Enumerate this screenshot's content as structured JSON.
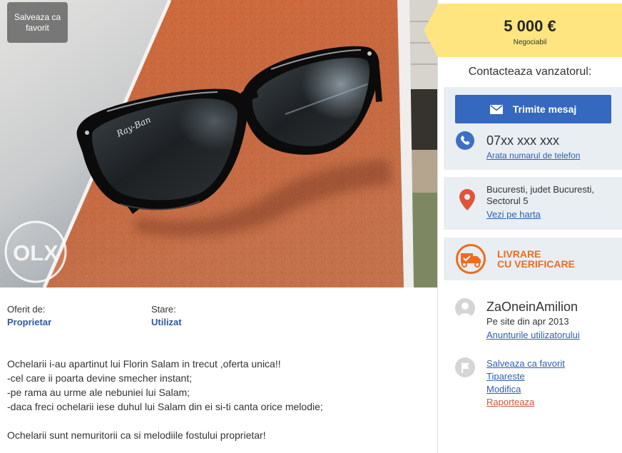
{
  "colors": {
    "accent": "#2f5fae",
    "button": "#3568bf",
    "price_background": "#ffe57f",
    "panel_background": "#e9eef3",
    "delivery": "#ee6c1e",
    "report_link": "#d0573c",
    "location_pin": "#e0553a"
  },
  "icons": {
    "send_message": "envelope-icon",
    "phone": "phone-icon",
    "location": "map-pin-icon",
    "delivery": "delivery-truck-icon",
    "user": "user-avatar-icon",
    "actions": "flag-icon"
  },
  "photo": {
    "save_favorite": "Salveaza ca favorit",
    "lens_logo": "Ray-Ban",
    "watermark": "OLX"
  },
  "details": {
    "offered_by": {
      "label": "Oferit de:",
      "value": "Proprietar"
    },
    "condition": {
      "label": "Stare:",
      "value": "Utilizat"
    }
  },
  "description": {
    "paragraph1": [
      "Ochelarii i-au apartinut lui Florin Salam in trecut ,oferta unica!!",
      "-cel care ii poarta devine smecher instant;",
      "-pe rama au urme ale nebuniei lui Salam;",
      "-daca freci ochelarii iese duhul lui Salam din ei si-ti canta orice melodie;"
    ],
    "paragraph2": "Ochelarii sunt nemuritorii ca si melodiile fostului proprietar!"
  },
  "sidebar": {
    "price": {
      "amount": "5 000 €",
      "note": "Negociabil"
    },
    "contact": {
      "heading": "Contacteaza vanzatorul:",
      "send_message": "Trimite mesaj",
      "phone": "07xx xxx xxx",
      "show_phone": "Arata numarul de telefon"
    },
    "location": {
      "lines": [
        "Bucuresti, judet Bucuresti,",
        "Sectorul 5"
      ],
      "map_link": "Vezi pe harta"
    },
    "delivery": {
      "line1": "LIVRARE",
      "line2": "CU VERIFICARE"
    },
    "user": {
      "name": "ZaOneinAmilion",
      "since": "Pe site din apr 2013",
      "ads_link": "Anunturile utilizatorului"
    },
    "actions": [
      "Salveaza ca favorit",
      "Tipareste",
      "Modifica",
      "Raporteaza"
    ]
  }
}
